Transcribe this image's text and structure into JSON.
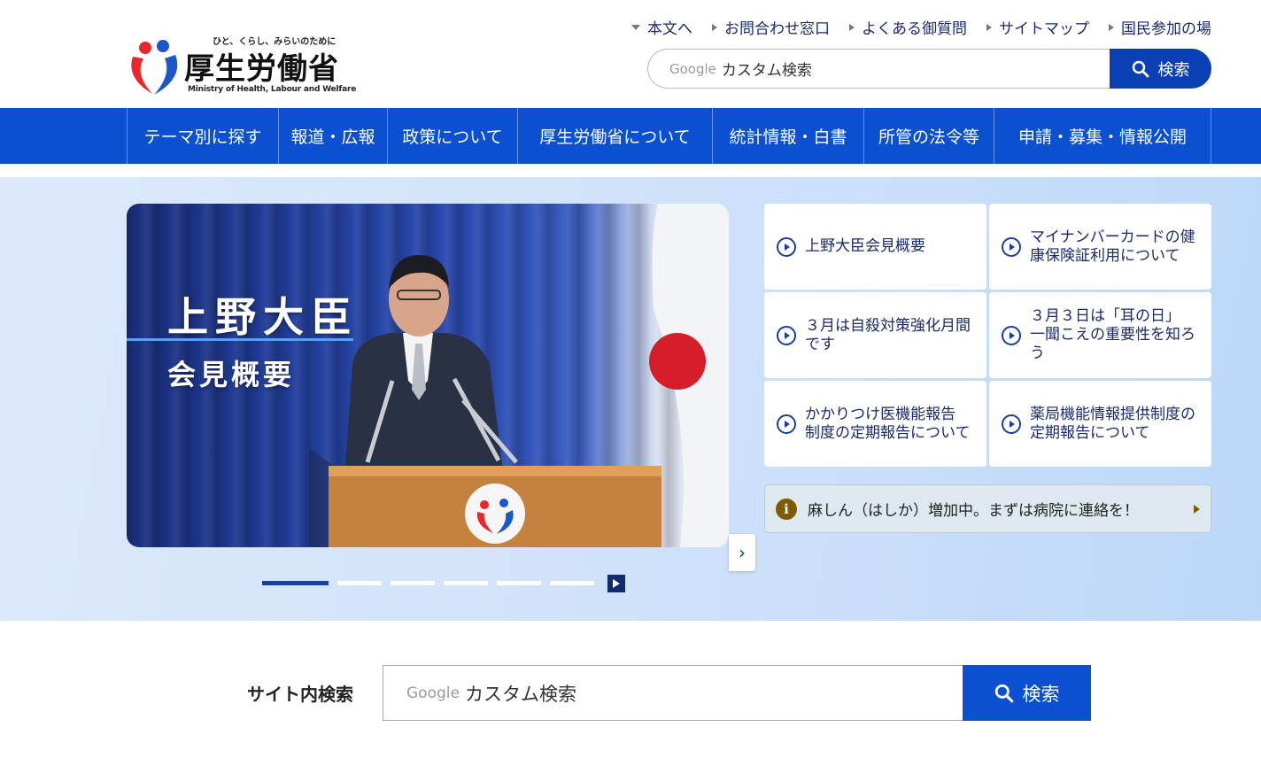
{
  "logo": {
    "tagline": "ひと、くらし、みらいのために",
    "name": "厚生労働省",
    "en": "Ministry of Health, Labour and Welfare"
  },
  "util_links": [
    "本文へ",
    "お問合わせ窓口",
    "よくある御質問",
    "サイトマップ",
    "国民参加の場"
  ],
  "top_search": {
    "brand": "Google",
    "placeholder": "カスタム検索",
    "button": "検索"
  },
  "nav": [
    "テーマ別に探す",
    "報道・広報",
    "政策について",
    "厚生労働省について",
    "統計情報・白書",
    "所管の法令等",
    "申請・募集・情報公開"
  ],
  "slide": {
    "title": "上野大臣",
    "subtitle": "会見概要"
  },
  "cards": [
    "上野大臣会見概要",
    "マイナンバーカードの健康保険証利用について",
    "３月は自殺対策強化月間です",
    "３月３日は「耳の日」 一聞こえの重要性を知ろう",
    "かかりつけ医機能報告制度の定期報告について",
    "薬局機能情報提供制度の定期報告について"
  ],
  "alert": {
    "text": "麻しん（はしか）増加中。まずは病院に連絡を！"
  },
  "site_search": {
    "label": "サイト内検索",
    "brand": "Google",
    "placeholder": "カスタム検索",
    "button": "検索"
  },
  "colors": {
    "nav_blue": "#0a50d0",
    "button_blue": "#0a3fb6",
    "card_text": "#1a2a6e"
  }
}
